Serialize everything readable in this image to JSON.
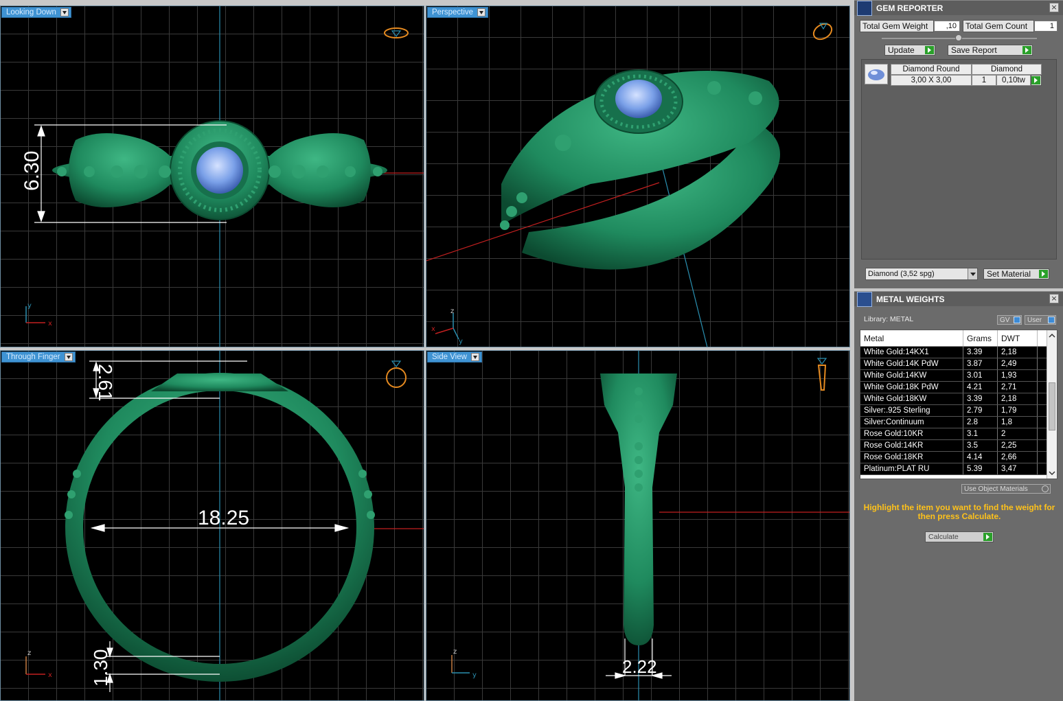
{
  "viewports": {
    "top_left": {
      "label": "Looking Down",
      "dimension": "6.30"
    },
    "top_right": {
      "label": "Perspective"
    },
    "bottom_left": {
      "label": "Through Finger",
      "dimension_top": "2.61",
      "dimension_inner": "18.25",
      "dimension_bottom": "1.30"
    },
    "bottom_right": {
      "label": "Side View",
      "dimension": "2.22"
    },
    "axes": {
      "x": "x",
      "y": "y",
      "z": "z"
    }
  },
  "gem_reporter": {
    "title": "GEM REPORTER",
    "total_weight_label": "Total Gem Weight",
    "total_weight_value": ",10",
    "total_count_label": "Total Gem Count",
    "total_count_value": "1",
    "update_label": "Update",
    "save_label": "Save Report",
    "gem": {
      "shape": "Diamond Round",
      "type": "Diamond",
      "size": "3,00 X 3,00",
      "count": "1",
      "weight": "0,10tw"
    },
    "material_select": "Diamond    (3,52 spg)",
    "set_material_label": "Set Material"
  },
  "metal_weights": {
    "title": "METAL WEIGHTS",
    "library_label": "Library: METAL",
    "toggle_gv": "GV",
    "toggle_user": "User",
    "columns": [
      "Metal",
      "Grams",
      "DWT"
    ],
    "rows": [
      [
        "White Gold:14KX1",
        "3.39",
        "2,18"
      ],
      [
        "White Gold:14K PdW",
        "3.87",
        "2,49"
      ],
      [
        "White Gold:14KW",
        "3.01",
        "1,93"
      ],
      [
        "White Gold:18K PdW",
        "4.21",
        "2,71"
      ],
      [
        "White Gold:18KW",
        "3.39",
        "2,18"
      ],
      [
        "Silver:.925 Sterling",
        "2.79",
        "1,79"
      ],
      [
        "Silver:Continuum",
        "2.8",
        "1,8"
      ],
      [
        "Rose Gold:10KR",
        "3.1",
        "2"
      ],
      [
        "Rose Gold:14KR",
        "3.5",
        "2,25"
      ],
      [
        "Rose Gold:18KR",
        "4.14",
        "2,66"
      ],
      [
        "Platinum:PLAT RU",
        "5.39",
        "3,47"
      ]
    ],
    "use_object_materials": "Use Object Materials",
    "hint": "Highlight the item you want to find the weight for then press Calculate.",
    "calculate_label": "Calculate"
  },
  "colors": {
    "ring_green": "#1f8a5e",
    "gem_blue": "#7aa0e8",
    "tab_blue": "#3f93d3",
    "hint_yellow": "#ffc21a",
    "axis_red": "#c42020",
    "axis_blue": "#2a8fb0"
  }
}
